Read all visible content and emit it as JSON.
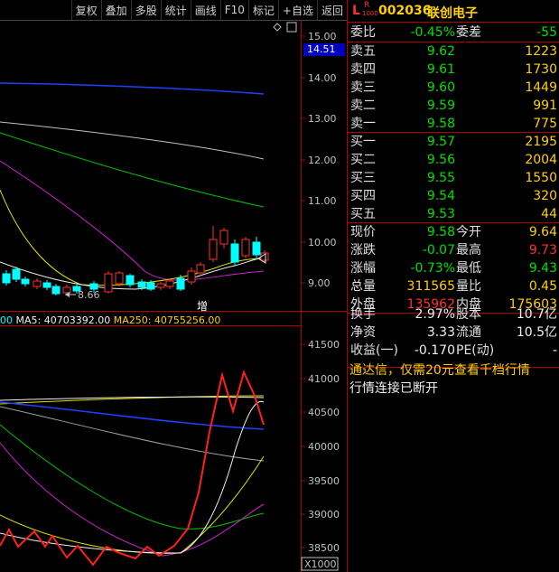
{
  "toolbar": {
    "items": [
      "复权",
      "叠加",
      "多股",
      "统计",
      "画线",
      "F10",
      "标记",
      "+自选",
      "返回"
    ]
  },
  "price_axis": {
    "labels": [
      "15.00",
      "14.00",
      "13.00",
      "12.00",
      "11.00",
      "10.00",
      "9.00"
    ],
    "current": "14.51",
    "low_marker": "8.66",
    "annotation": "增"
  },
  "volume_axis": {
    "labels": [
      "41500",
      "41000",
      "40500",
      "40000",
      "39500",
      "39000",
      "38500"
    ],
    "unit": "X1000"
  },
  "indicator": {
    "lead": "00",
    "ma5_label": "MA5: 40703392.00",
    "ma250_label": "MA250: 40755256.00"
  },
  "stock": {
    "prefix_l": "L",
    "prefix_r": "R",
    "prefix_sub": "1000",
    "code": "002036",
    "name": "联创电子"
  },
  "commission": {
    "ratio_label": "委比",
    "ratio_value": "-0.45%",
    "diff_label": "委差",
    "diff_value": "-55"
  },
  "asks": [
    {
      "label": "卖五",
      "price": "9.62",
      "vol": "1223"
    },
    {
      "label": "卖四",
      "price": "9.61",
      "vol": "1730"
    },
    {
      "label": "卖三",
      "price": "9.60",
      "vol": "1449"
    },
    {
      "label": "卖二",
      "price": "9.59",
      "vol": "991"
    },
    {
      "label": "卖一",
      "price": "9.58",
      "vol": "775"
    }
  ],
  "bids": [
    {
      "label": "买一",
      "price": "9.57",
      "vol": "2195"
    },
    {
      "label": "买二",
      "price": "9.56",
      "vol": "2004"
    },
    {
      "label": "买三",
      "price": "9.55",
      "vol": "1550"
    },
    {
      "label": "买四",
      "price": "9.54",
      "vol": "320"
    },
    {
      "label": "买五",
      "price": "9.53",
      "vol": "44"
    }
  ],
  "quote": [
    {
      "l1": "现价",
      "v1": "9.58",
      "l2": "今开",
      "v2": "9.64"
    },
    {
      "l1": "涨跌",
      "v1": "-0.07",
      "l2": "最高",
      "v2": "9.73"
    },
    {
      "l1": "涨幅",
      "v1": "-0.73%",
      "l2": "最低",
      "v2": "9.43"
    },
    {
      "l1": "总量",
      "v1": "311565",
      "l2": "量比",
      "v2": "0.45"
    },
    {
      "l1": "外盘",
      "v1": "135962",
      "l2": "内盘",
      "v2": "175603"
    }
  ],
  "fundamentals": [
    {
      "l1": "换手",
      "v1": "2.97%",
      "l2": "股本",
      "v2": "10.7亿"
    },
    {
      "l1": "净资",
      "v1": "3.33",
      "l2": "流通",
      "v2": "10.5亿"
    },
    {
      "l1": "收益(一)",
      "v1": "-0.170",
      "l2": "PE(动)",
      "v2": "-"
    }
  ],
  "notice": "通达信，仅需20元查看千档行情",
  "status": "行情连接已断开"
}
